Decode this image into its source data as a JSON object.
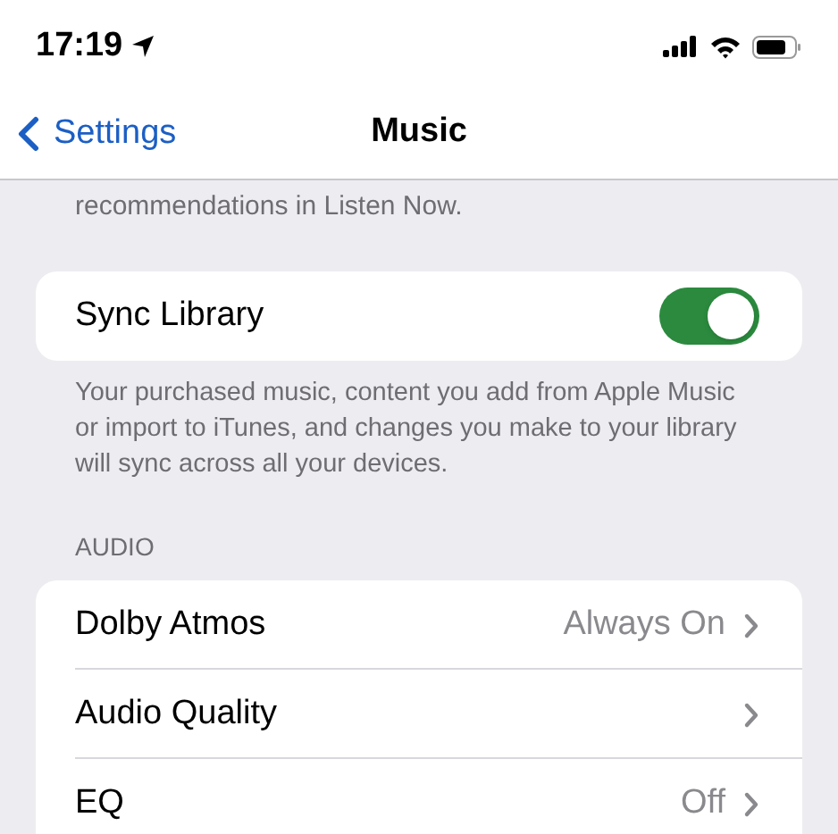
{
  "status_bar": {
    "time": "17:19"
  },
  "nav": {
    "back": "Settings",
    "title": "Music"
  },
  "partial_footer": "recommendations in Listen Now.",
  "sync": {
    "label": "Sync Library",
    "on": true,
    "footer": "Your purchased music, content you add from Apple Music or import to iTunes, and changes you make to your library will sync across all your devices."
  },
  "audio": {
    "header": "AUDIO",
    "rows": [
      {
        "label": "Dolby Atmos",
        "value": "Always On"
      },
      {
        "label": "Audio Quality"
      },
      {
        "label": "EQ",
        "value": "Off"
      }
    ]
  }
}
